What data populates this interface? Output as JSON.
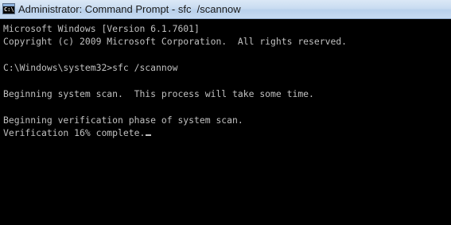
{
  "window": {
    "title": "Administrator: Command Prompt - sfc  /scannow",
    "icon": "cmd-prompt-icon",
    "icon_glyph": "C:\\"
  },
  "console": {
    "lines": [
      "Microsoft Windows [Version 6.1.7601]",
      "Copyright (c) 2009 Microsoft Corporation.  All rights reserved.",
      "",
      "C:\\Windows\\system32>sfc /scannow",
      "",
      "Beginning system scan.  This process will take some time.",
      "",
      "Beginning verification phase of system scan.",
      "Verification 16% complete."
    ]
  },
  "colors": {
    "console_background": "#000000",
    "console_text": "#c0c0c0",
    "titlebar_top": "#dbe8f6",
    "titlebar_bottom": "#b8d0ec"
  }
}
